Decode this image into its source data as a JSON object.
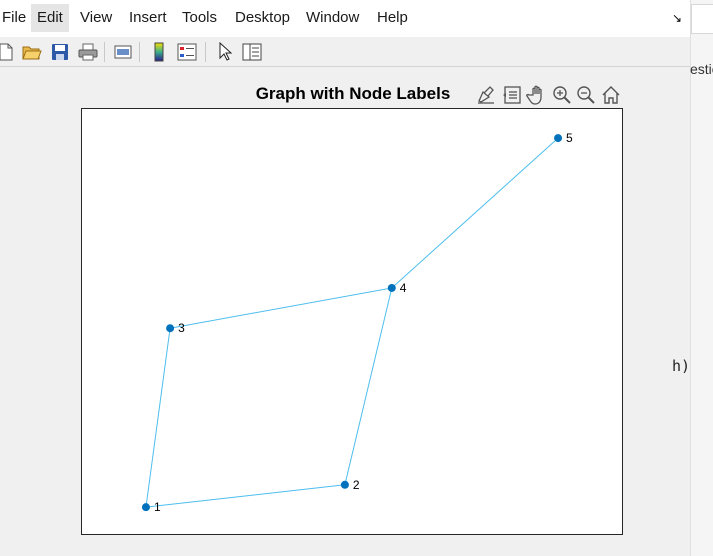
{
  "menu": {
    "items": [
      "File",
      "Edit",
      "View",
      "Insert",
      "Tools",
      "Desktop",
      "Window",
      "Help"
    ]
  },
  "toolbar": {
    "buttons": [
      "new-figure-icon",
      "open-file-icon",
      "save-icon",
      "print-icon",
      "link-plot-icon",
      "insert-colorbar-icon",
      "insert-legend-icon",
      "edit-plot-icon",
      "property-inspector-icon"
    ]
  },
  "axes_toolbar": {
    "buttons": [
      "brush-icon",
      "data-tips-icon",
      "pan-hand-icon",
      "zoom-in-icon",
      "zoom-out-icon",
      "restore-view-icon"
    ]
  },
  "background_text": {
    "fragment_top": "estio",
    "fragment_code": "h),"
  },
  "chart_data": {
    "type": "graph",
    "title": "Graph with Node Labels",
    "nodes": [
      {
        "label": "1",
        "x": 1.0,
        "y": 1.0
      },
      {
        "label": "2",
        "x": 2.4,
        "y": 1.1
      },
      {
        "label": "3",
        "x": 1.17,
        "y": 1.8
      },
      {
        "label": "4",
        "x": 2.73,
        "y": 1.98
      },
      {
        "label": "5",
        "x": 3.9,
        "y": 2.65
      }
    ],
    "edges": [
      [
        "1",
        "2"
      ],
      [
        "1",
        "3"
      ],
      [
        "2",
        "4"
      ],
      [
        "3",
        "4"
      ],
      [
        "4",
        "5"
      ]
    ],
    "xlim": [
      0.55,
      4.35
    ],
    "ylim": [
      0.88,
      2.78
    ],
    "node_color": "#0072BD",
    "edge_color": "#4DBEEE",
    "grid": false
  }
}
